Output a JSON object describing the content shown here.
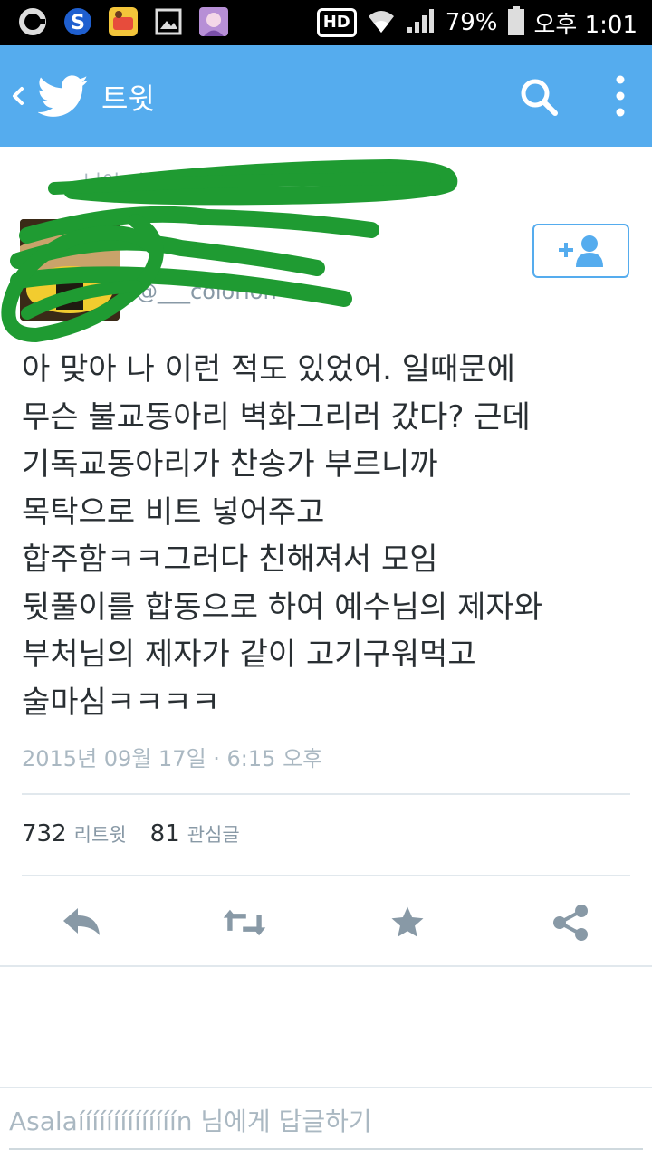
{
  "status_bar": {
    "hd": "HD",
    "battery": "79%",
    "time": "오후 1:01",
    "left_icons": [
      "ring-icon",
      "s-logo-icon",
      "game-app-icon",
      "gallery-icon",
      "anime-app-icon"
    ]
  },
  "app_bar": {
    "title": "트윗",
    "background": "#55acee",
    "icons": [
      "back-chevron-icon",
      "twitter-bird-icon",
      "search-icon",
      "more-vert-icon"
    ]
  },
  "tweet": {
    "retweet_line": "님이 리트윗함",
    "author_display_name": "",
    "author_screen_name": "@___colorion",
    "lines": [
      "아 맞아 나 이런 적도 있었어. 일때문에",
      "무슨 불교동아리 벽화그리러 갔다? 근데",
      "기독교동아리가 찬송가 부르니까",
      "목탁으로 비트 넣어주고",
      "합주함ㅋㅋ그러다 친해져서 모임",
      "뒷풀이를 합동으로 하여 예수님의 제자와",
      "부처님의 제자가 같이 고기구워먹고",
      "술마심ㅋㅋㅋㅋ"
    ],
    "timestamp": "2015년 09월 17일 · 6:15 오후",
    "retweets_count": "732",
    "retweets_label": "리트윗",
    "favorites_count": "81",
    "favorites_label": "관심글"
  },
  "actions": [
    "reply-icon",
    "retweet-icon",
    "favorite-star-icon",
    "share-icon"
  ],
  "reply": {
    "placeholder": "Asalaíííííííííííííín 님에게 답글하기"
  },
  "colors": {
    "twitter_blue": "#55acee",
    "action_gray": "#8899a6",
    "redaction_green": "#1f9b32"
  }
}
